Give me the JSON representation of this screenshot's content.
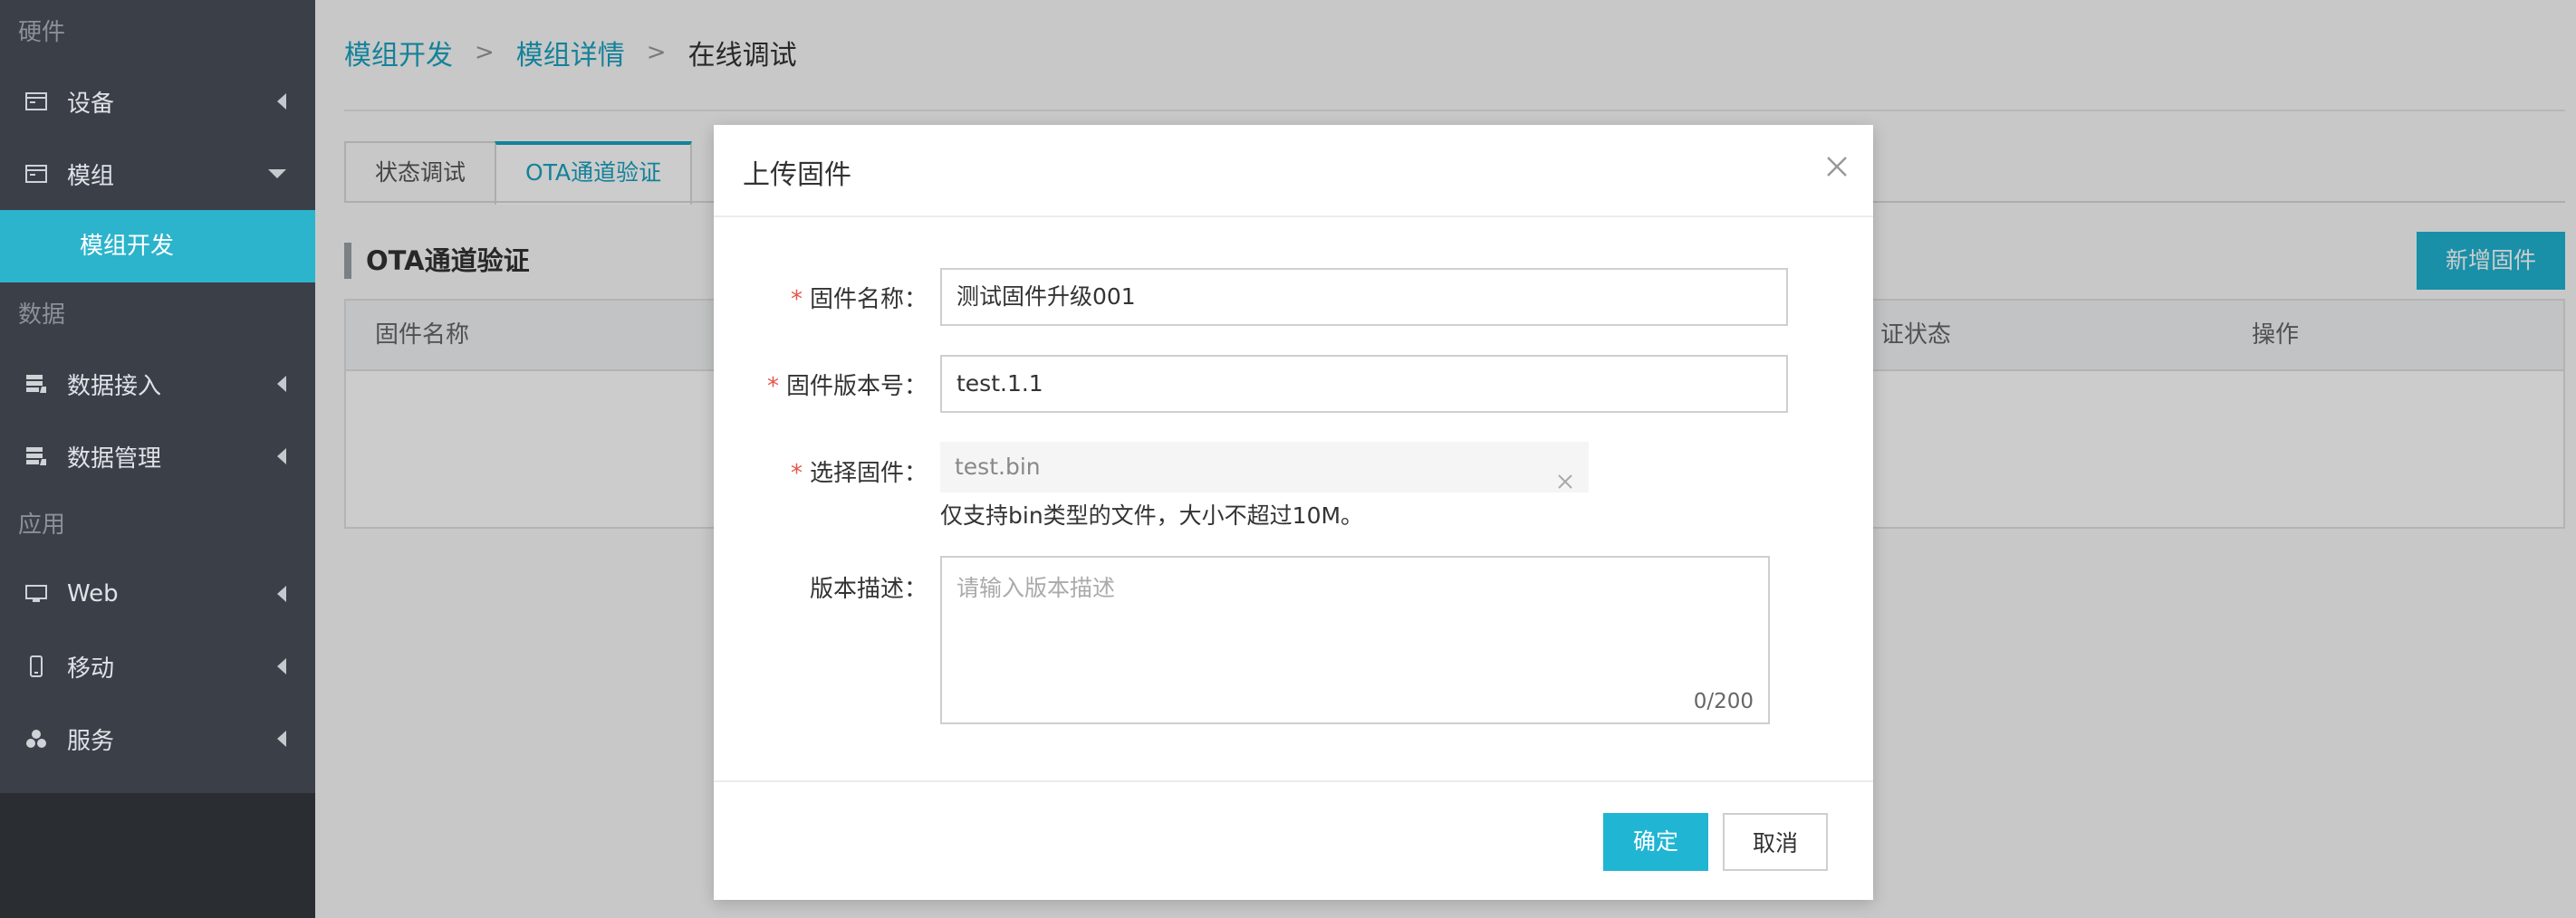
{
  "sidebar": {
    "sections": [
      {
        "label": "硬件"
      },
      {
        "label": "数据"
      },
      {
        "label": "应用"
      }
    ],
    "items": {
      "device": "设备",
      "module": "模组",
      "module_dev": "模组开发",
      "data_access": "数据接入",
      "data_manage": "数据管理",
      "web": "Web",
      "mobile": "移动",
      "service": "服务"
    }
  },
  "breadcrumb": {
    "items": [
      "模组开发",
      "模组详情"
    ],
    "current": "在线调试"
  },
  "tabs": [
    "状态调试",
    "OTA通道验证"
  ],
  "section_title": "OTA通道验证",
  "new_button": "新增固件",
  "table": {
    "headers": {
      "name": "固件名称",
      "status": "证状态",
      "action": "操作"
    }
  },
  "modal": {
    "title": "上传固件",
    "fields": {
      "name": {
        "label": "固件名称：",
        "value": "测试固件升级001"
      },
      "version": {
        "label": "固件版本号：",
        "value": "test.1.1"
      },
      "file": {
        "label": "选择固件：",
        "value": "test.bin",
        "hint": "仅支持bin类型的文件，大小不超过10M。"
      },
      "desc": {
        "label": "版本描述：",
        "placeholder": "请输入版本描述",
        "counter": "0/200"
      }
    },
    "ok": "确定",
    "cancel": "取消"
  },
  "colors": {
    "accent": "#20b5d3",
    "sidebar_bg": "#3b3f48",
    "required": "#e5534b"
  }
}
